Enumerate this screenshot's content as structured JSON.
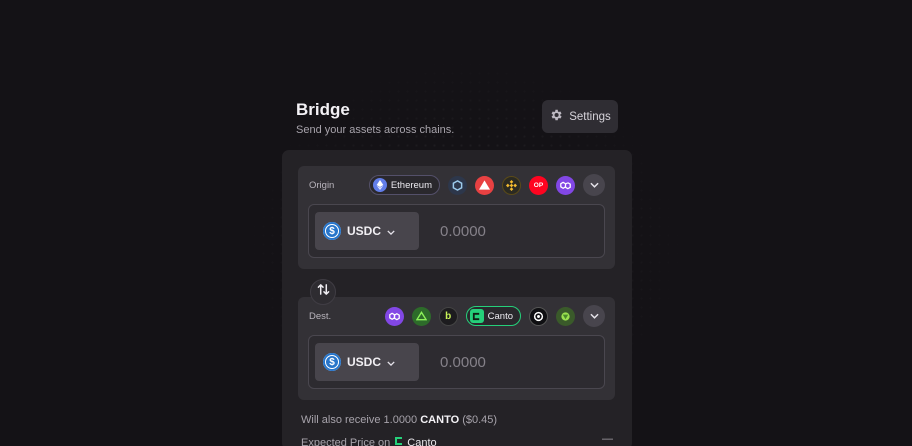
{
  "header": {
    "title": "Bridge",
    "subtitle": "Send your assets across chains.",
    "settings_label": "Settings"
  },
  "origin": {
    "label": "Origin",
    "selected_chain": "Ethereum",
    "other_chains": [
      "arbitrum-icon",
      "avalanche-icon",
      "bnb-icon",
      "optimism-icon",
      "polygon-icon"
    ],
    "token": "USDC",
    "amount_placeholder": "0.0000"
  },
  "dest": {
    "label": "Dest.",
    "selected_chain": "Canto",
    "other_chains_left": [
      "polygon-icon",
      "arbitrum-nova-icon",
      "base-icon"
    ],
    "other_chains_right": [
      "celo-icon",
      "metis-icon"
    ],
    "token": "USDC",
    "amount_placeholder": "0.0000"
  },
  "receive": {
    "prefix": "Will also receive 1.0000",
    "token": "CANTO",
    "usd": "($0.45)"
  },
  "expected": {
    "label": "Expected Price on",
    "chain": "Canto",
    "value": "—"
  },
  "colors": {
    "background": "#141216",
    "panel": "#242226",
    "section": "#333136",
    "canto_green": "#25d07a",
    "usdc_blue": "#2775ca"
  }
}
